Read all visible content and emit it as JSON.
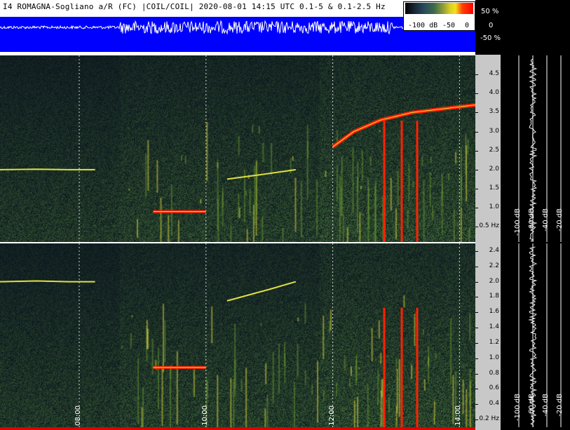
{
  "header": {
    "title": "I4 ROMAGNA-Sogliano a/R (FC) |COIL/COIL| 2020-08-01 14:15 UTC 0.1-5 & 0.1-2.5  Hz"
  },
  "colorbar": {
    "labels": [
      "-100 dB",
      "-50",
      "0"
    ]
  },
  "amplitude_axis": [
    "50 %",
    "0",
    "-50 %"
  ],
  "chart_data": [
    {
      "type": "heatmap",
      "title": "",
      "xlabel": "",
      "ylabel": "",
      "x_ticks": [
        "08:00",
        "10:00",
        "12:00",
        "14:00"
      ],
      "x_range": [
        "06:45",
        "14:15"
      ],
      "y_ticks": [
        "0.5 Hz",
        "1.0",
        "1.5",
        "2.0",
        "2.5",
        "3.0",
        "3.5",
        "4.0",
        "4.5"
      ],
      "y_range": [
        0.1,
        5.0
      ],
      "grid": true,
      "traces": [
        {
          "x": [
            "06:45",
            "07:20",
            "07:50",
            "08:15"
          ],
          "y": [
            2.0,
            2.01,
            2.0,
            2.0
          ]
        },
        {
          "x": [
            "09:10",
            "09:30",
            "09:50",
            "10:00"
          ],
          "y": [
            0.9,
            0.9,
            0.9,
            0.9
          ]
        },
        {
          "x": [
            "10:20",
            "11:00",
            "11:25"
          ],
          "y": [
            1.75,
            1.9,
            2.0
          ]
        },
        {
          "x": [
            "12:00",
            "12:20",
            "12:45",
            "13:15",
            "13:45",
            "14:15"
          ],
          "y": [
            2.6,
            3.0,
            3.3,
            3.5,
            3.6,
            3.7
          ]
        }
      ],
      "side_spectrum_ticks": [
        "-100 dB",
        "-60 dB",
        "-40 dB",
        "-20 dB"
      ]
    },
    {
      "type": "heatmap",
      "title": "",
      "xlabel": "",
      "ylabel": "",
      "x_ticks": [
        "08:00",
        "10:00",
        "12:00",
        "14:00"
      ],
      "x_range": [
        "06:45",
        "14:15"
      ],
      "y_ticks": [
        "0.2 Hz",
        "0.4",
        "0.6",
        "0.8",
        "1.0",
        "1.2",
        "1.4",
        "1.6",
        "1.8",
        "2.0",
        "2.2",
        "2.4"
      ],
      "y_range": [
        0.1,
        2.5
      ],
      "grid": true,
      "traces": [
        {
          "x": [
            "06:45",
            "07:20",
            "07:50",
            "08:15"
          ],
          "y": [
            2.0,
            2.01,
            2.0,
            2.0
          ]
        },
        {
          "x": [
            "09:10",
            "09:30",
            "09:50",
            "10:00"
          ],
          "y": [
            0.88,
            0.88,
            0.88,
            0.88
          ]
        },
        {
          "x": [
            "10:20",
            "11:00",
            "11:25"
          ],
          "y": [
            1.75,
            1.9,
            2.0
          ]
        }
      ],
      "side_spectrum_ticks": [
        "-100 dB",
        "-60 dB",
        "-40 dB",
        "-20 dB"
      ]
    }
  ],
  "colors": {
    "background": "#0a1420",
    "noise": "#4a6a2a",
    "hot": "#ff2000",
    "waveform_bg": "#0000ff"
  }
}
